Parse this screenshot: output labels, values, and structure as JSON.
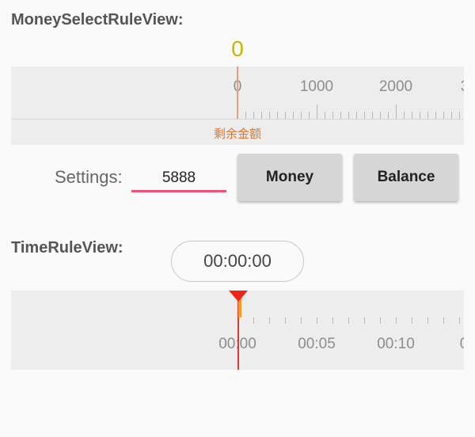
{
  "money_section": {
    "title": "MoneySelectRuleView:",
    "current_value": "0",
    "ruler_labels": [
      "0",
      "1000",
      "2000",
      "3"
    ],
    "caption": "剩余金额"
  },
  "settings": {
    "label": "Settings:",
    "input_value": "5888",
    "money_button": "Money",
    "balance_button": "Balance"
  },
  "time_section": {
    "title": "TimeRuleView:",
    "display": "00:00:00",
    "ruler_labels": [
      "00:00",
      "00:05",
      "00:10",
      "0"
    ]
  },
  "colors": {
    "money_value": "#c9b400",
    "caption": "#e0742a",
    "input_underline": "#f0507a",
    "time_marker": "#f22414",
    "time_bar": "#f59e22"
  }
}
